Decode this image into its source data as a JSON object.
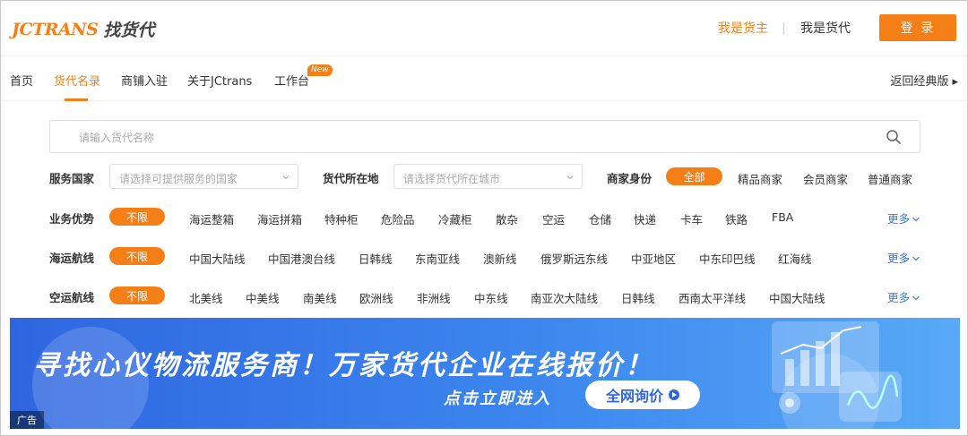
{
  "header": {
    "logo_en": "JCTRANS",
    "logo_cn": "找货代",
    "links": [
      {
        "label": "我是货主",
        "active": true
      },
      {
        "label": "我是货代",
        "active": false
      }
    ],
    "login_label": "登 录"
  },
  "nav": {
    "items": [
      {
        "label": "首页",
        "active": false
      },
      {
        "label": "货代名录",
        "active": true
      },
      {
        "label": "商铺入驻",
        "active": false
      },
      {
        "label": "关于JCtrans",
        "active": false
      },
      {
        "label": "工作台",
        "active": false
      }
    ],
    "new_badge": "New",
    "back_classic": "返回经典版 ▸"
  },
  "search": {
    "placeholder": "请输入货代名称",
    "icon": "search-icon"
  },
  "filters": {
    "country_label": "服务国家",
    "country_placeholder": "请选择可提供服务的国家",
    "city_label": "货代所在地",
    "city_placeholder": "请选择货代所在城市",
    "identity_label": "商家身份",
    "identity_options": [
      "全部",
      "精品商家",
      "会员商家",
      "普通商家"
    ],
    "business": {
      "label": "业务优势",
      "all": "不限",
      "options": [
        "海运整箱",
        "海运拼箱",
        "特种柜",
        "危险品",
        "冷藏柜",
        "散杂",
        "空运",
        "仓储",
        "快递",
        "卡车",
        "铁路",
        "FBA"
      ],
      "more": "更多"
    },
    "sea_routes": {
      "label": "海运航线",
      "all": "不限",
      "options": [
        "中国大陆线",
        "中国港澳台线",
        "日韩线",
        "东南亚线",
        "澳新线",
        "俄罗斯远东线",
        "中亚地区",
        "中东印巴线",
        "红海线"
      ],
      "more": "更多"
    },
    "air_routes": {
      "label": "空运航线",
      "all": "不限",
      "options": [
        "北美线",
        "中美线",
        "南美线",
        "欧洲线",
        "非洲线",
        "中东线",
        "南亚次大陆线",
        "日韩线",
        "西南太平洋线",
        "中国大陆线"
      ],
      "more": "更多"
    }
  },
  "banner": {
    "title": "寻找心仪物流服务商！万家货代企业在线报价！",
    "subtitle": "点击立即进入",
    "button": "全网询价",
    "ad_tag": "广告"
  },
  "colors": {
    "accent": "#f57f17",
    "link": "#3a7bd5",
    "banner": "#2f66e0"
  }
}
